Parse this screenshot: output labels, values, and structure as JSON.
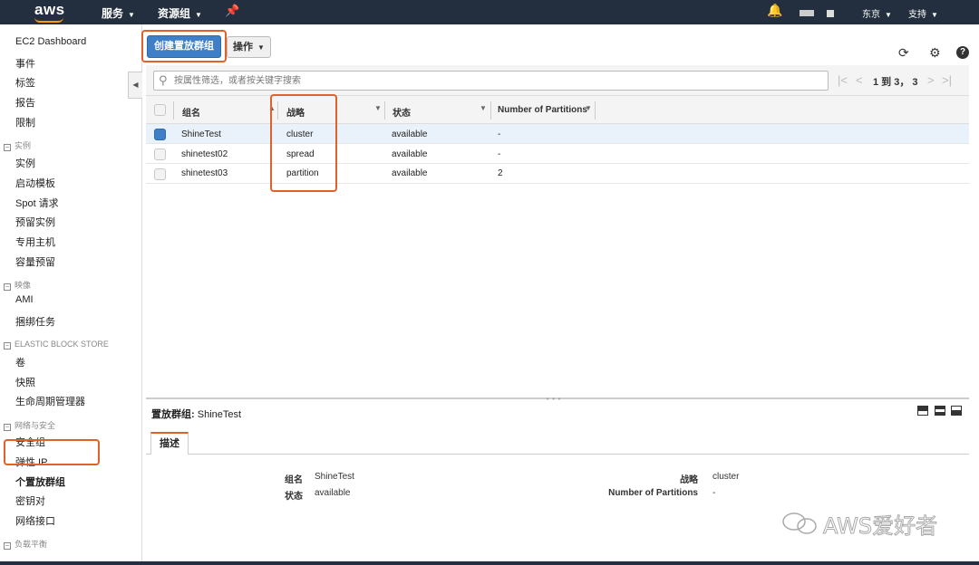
{
  "topnav": {
    "logo": "aws",
    "services": "服务",
    "resource_groups": "资源组",
    "region": "东京",
    "support": "支持"
  },
  "sidebar": {
    "top_items": [
      "EC2 Dashboard",
      "事件",
      "标签",
      "报告",
      "限制"
    ],
    "sections": [
      {
        "title": "实例",
        "items": [
          "实例",
          "启动模板",
          "Spot 请求",
          "预留实例",
          "专用主机",
          "容量预留"
        ]
      },
      {
        "title": "映像",
        "items": [
          "AMI",
          "捆绑任务"
        ]
      },
      {
        "title": "ELASTIC BLOCK STORE",
        "items": [
          "卷",
          "快照",
          "生命周期管理器"
        ]
      },
      {
        "title": "网络与安全",
        "items": [
          "安全组",
          "弹性 IP",
          "个置放群组",
          "密钥对",
          "网络接口"
        ]
      },
      {
        "title": "负载平衡",
        "items": []
      }
    ]
  },
  "toolbar": {
    "create_label": "创建置放群组",
    "actions_label": "操作"
  },
  "search": {
    "placeholder": "按属性筛选，或者按关键字搜索",
    "pager": "1 到 3， 3"
  },
  "table": {
    "headers": [
      "组名",
      "战略",
      "状态",
      "Number of Partitions"
    ],
    "rows": [
      {
        "name": "ShineTest",
        "strategy": "cluster",
        "state": "available",
        "partitions": "-",
        "selected": true
      },
      {
        "name": "shinetest02",
        "strategy": "spread",
        "state": "available",
        "partitions": "-",
        "selected": false
      },
      {
        "name": "shinetest03",
        "strategy": "partition",
        "state": "available",
        "partitions": "2",
        "selected": false
      }
    ]
  },
  "detail": {
    "title_label": "置放群组:",
    "title_value": "ShineTest",
    "tab": "描述",
    "fields": {
      "name_label": "组名",
      "name_value": "ShineTest",
      "state_label": "状态",
      "state_value": "available",
      "strategy_label": "战略",
      "strategy_value": "cluster",
      "partitions_label": "Number of Partitions",
      "partitions_value": "-"
    }
  },
  "watermark": "AWS爱好者",
  "colors": {
    "nav_bg": "#232f3e",
    "primary_button": "#3f7fc8",
    "highlight_box": "#e0622b",
    "selected_row": "#e9f1fb"
  }
}
